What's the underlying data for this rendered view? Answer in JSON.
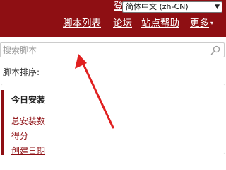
{
  "header": {
    "login_label": "登录",
    "language_selected": "简体中文 (zh-CN)",
    "bg_color": "#8e0f13"
  },
  "nav": {
    "items": [
      "脚本列表",
      "论坛",
      "站点帮助",
      "更多"
    ],
    "more_caret": "▾"
  },
  "search": {
    "placeholder": "搜索脚本",
    "icon": "search-icon"
  },
  "sort": {
    "label": "脚本排序:",
    "options": [
      {
        "label": "今日安装",
        "active": true
      },
      {
        "label": "总安装数",
        "active": false
      },
      {
        "label": "得分",
        "active": false
      },
      {
        "label": "创建日期",
        "active": false
      }
    ]
  },
  "annotation": {
    "arrow_color": "#e02020"
  }
}
